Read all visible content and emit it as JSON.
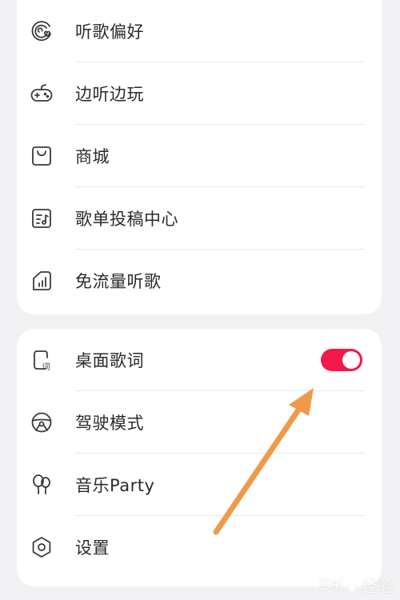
{
  "colors": {
    "toggle_on": "#f2184a",
    "arrow": "#ef9a4a",
    "icon_stroke": "#3a3a3a"
  },
  "menu_top": {
    "items": [
      {
        "label": "听歌偏好",
        "icon": "music-heart-icon"
      },
      {
        "label": "边听边玩",
        "icon": "gamepad-icon"
      },
      {
        "label": "商城",
        "icon": "shopping-bag-icon"
      },
      {
        "label": "歌单投稿中心",
        "icon": "playlist-submit-icon"
      },
      {
        "label": "免流量听歌",
        "icon": "signal-bars-icon"
      }
    ]
  },
  "menu_bottom": {
    "items": [
      {
        "label": "桌面歌词",
        "icon": "desktop-lyrics-icon",
        "toggle": true
      },
      {
        "label": "驾驶模式",
        "icon": "steering-wheel-icon"
      },
      {
        "label": "音乐Party",
        "icon": "balloons-icon"
      },
      {
        "label": "设置",
        "icon": "gear-icon"
      }
    ]
  },
  "watermark": {
    "text": "Bai",
    "suffix": "经验"
  }
}
